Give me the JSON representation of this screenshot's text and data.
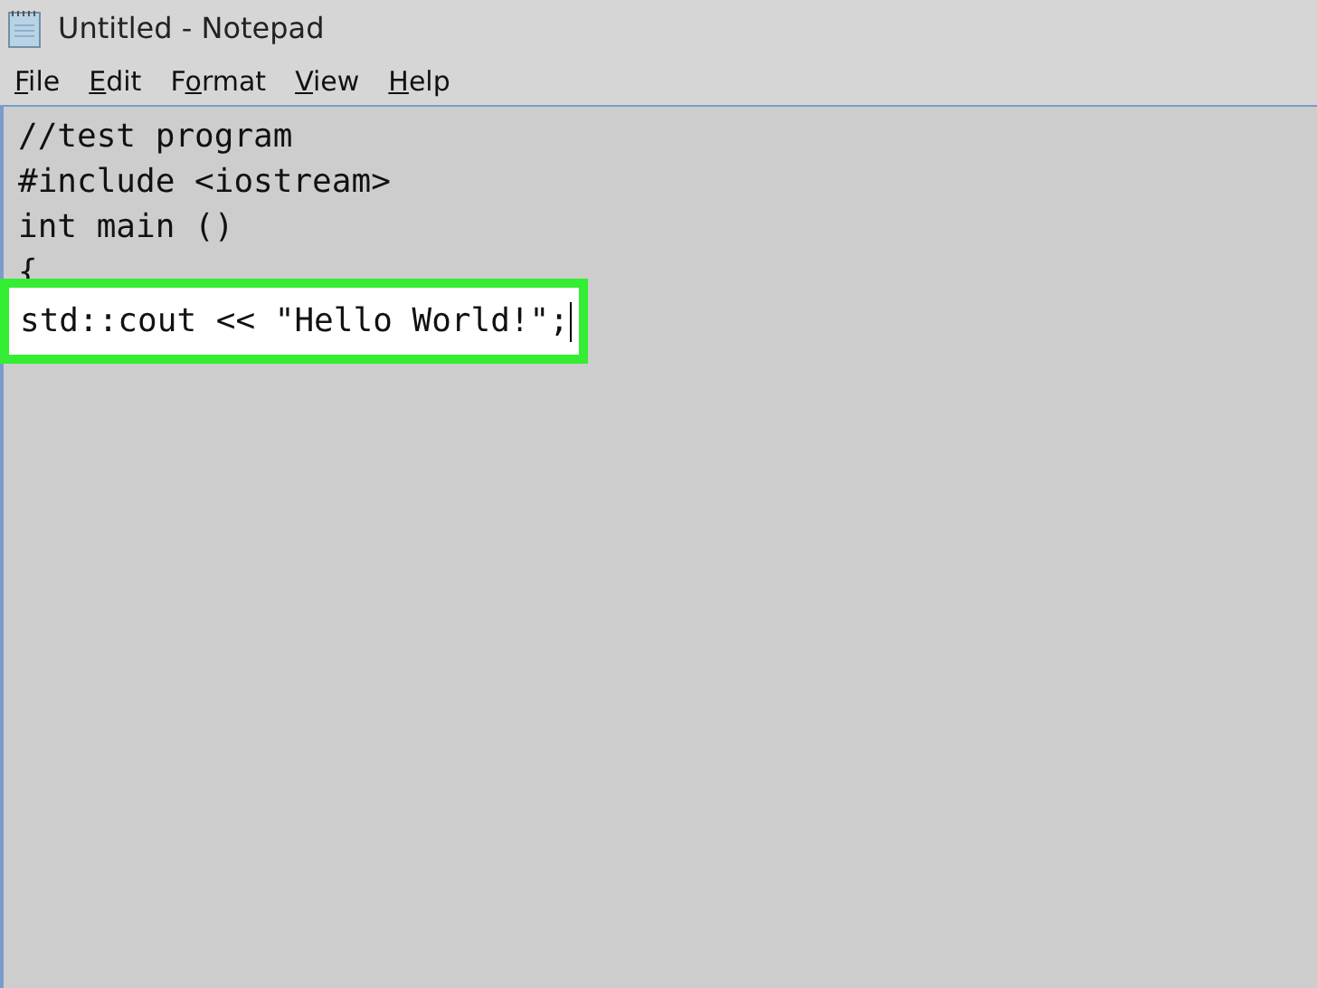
{
  "window": {
    "title": "Untitled - Notepad"
  },
  "menu": [
    {
      "parts": [
        {
          "text": "F",
          "underlined": true
        },
        {
          "text": "ile",
          "underlined": false
        }
      ]
    },
    {
      "parts": [
        {
          "text": "E",
          "underlined": true
        },
        {
          "text": "dit",
          "underlined": false
        }
      ]
    },
    {
      "parts": [
        {
          "text": "F",
          "underlined": false
        },
        {
          "text": "o",
          "underlined": true
        },
        {
          "text": "rmat",
          "underlined": false
        }
      ]
    },
    {
      "parts": [
        {
          "text": "V",
          "underlined": true
        },
        {
          "text": "iew",
          "underlined": false
        }
      ]
    },
    {
      "parts": [
        {
          "text": "H",
          "underlined": true
        },
        {
          "text": "elp",
          "underlined": false
        }
      ]
    }
  ],
  "editor": {
    "lines": [
      {
        "text": "//test program",
        "highlighted": false,
        "caret": false
      },
      {
        "text": "#include <iostream>",
        "highlighted": false,
        "caret": false
      },
      {
        "text": "int main ()",
        "highlighted": false,
        "caret": false
      },
      {
        "text": "{",
        "highlighted": false,
        "caret": false
      },
      {
        "text": "std::cout << \"Hello World!\";",
        "highlighted": true,
        "caret": true
      }
    ]
  }
}
